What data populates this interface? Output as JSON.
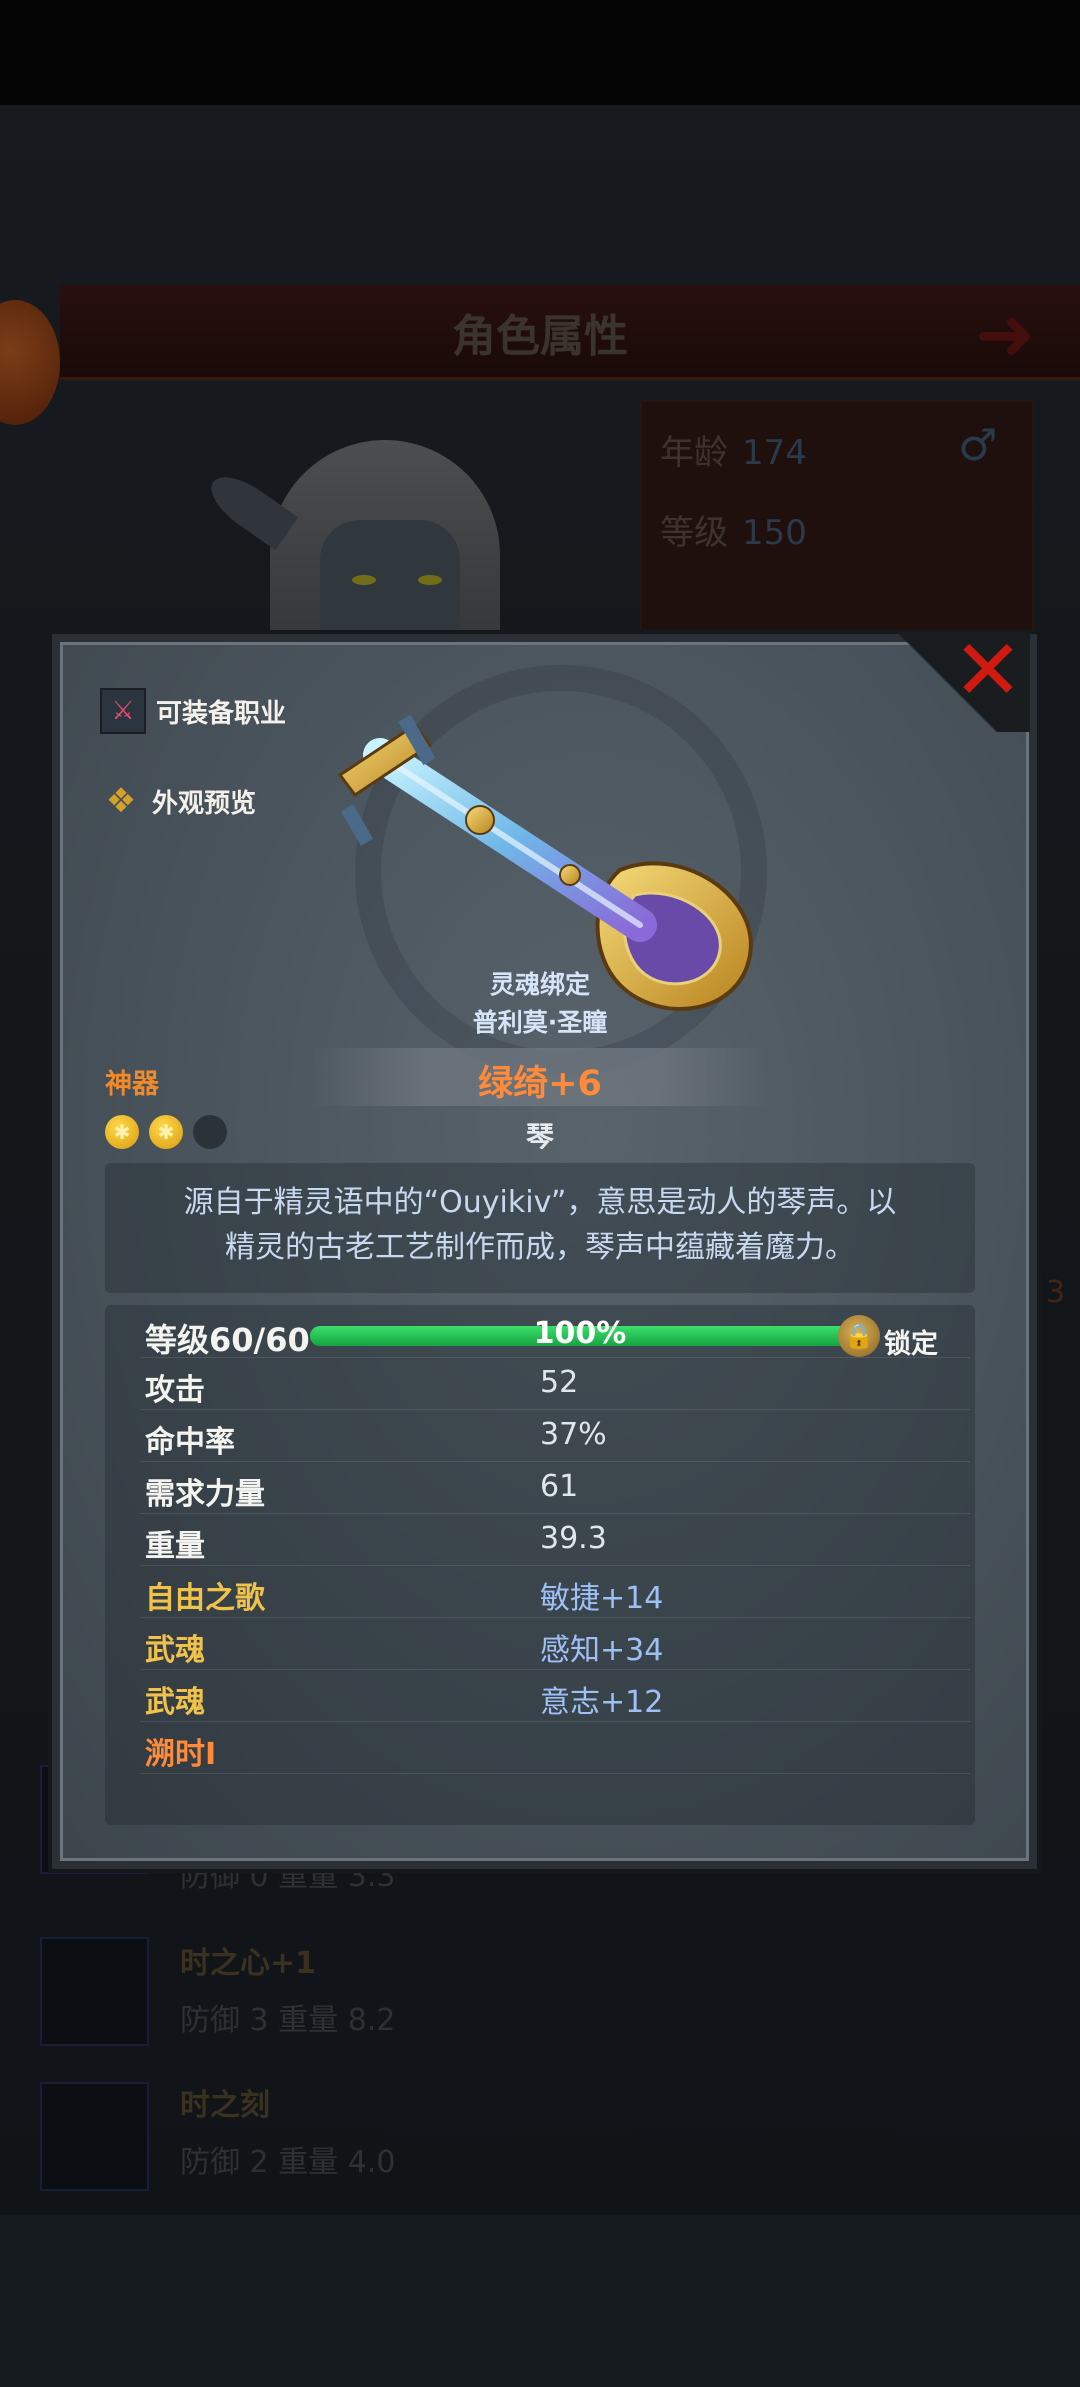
{
  "background": {
    "header_title": "角色属性",
    "stats": [
      {
        "label": "年龄",
        "value": "174"
      },
      {
        "label": "等级",
        "value": "150"
      }
    ],
    "equipment_list": [
      {
        "name": "",
        "sub": "防御 0 重量 3.3"
      },
      {
        "name": "时之心+1",
        "sub": "防御 3 重量 8.2"
      },
      {
        "name": "时之刻",
        "sub": "防御 2 重量 4.0"
      }
    ],
    "side_number": "3"
  },
  "modal": {
    "links": {
      "equip_classes": "可装备职业",
      "appearance_preview": "外观预览"
    },
    "soul_bound": "灵魂绑定",
    "maker": "普利莫·圣瞳",
    "rarity": "神器",
    "weapon_name": "绿绮+6",
    "weapon_type": "琴",
    "gems": [
      "on",
      "on",
      "off"
    ],
    "description_lines": [
      "源自于精灵语中的“Ouyikiv”，意思是动人的琴声。以",
      "精灵的古老工艺制作而成，琴声中蕴藏着魔力。"
    ],
    "level": {
      "label": "等级60/60",
      "progress_percent": 100,
      "percent_text": "100%",
      "lock_label": "锁定"
    },
    "attributes": [
      {
        "label": "攻击",
        "value": "52"
      },
      {
        "label": "命中率",
        "value": "37%"
      },
      {
        "label": "需求力量",
        "value": "61"
      },
      {
        "label": "重量",
        "value": "39.3"
      },
      {
        "label": "自由之歌",
        "value": "敏捷+14"
      },
      {
        "label": "武魂",
        "value": "感知+34"
      },
      {
        "label": "武魂",
        "value": "意志+12"
      },
      {
        "label": "溯时I",
        "value": ""
      }
    ]
  },
  "colors": {
    "rarity_orange": "#ff8b3a",
    "bonus_blue": "#9fc0f5",
    "progress_green": "#26c152",
    "close_red": "#d01a10"
  }
}
